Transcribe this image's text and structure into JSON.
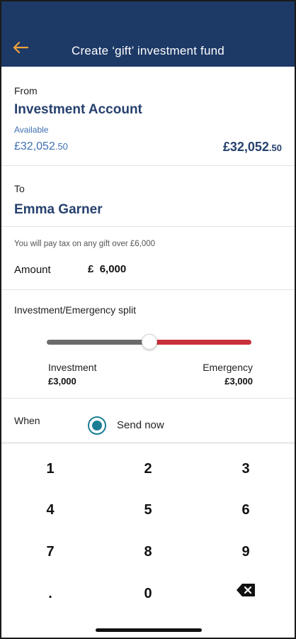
{
  "header": {
    "title": "Create ‘gift’ investment fund",
    "back_icon": "arrow-left-icon"
  },
  "from": {
    "label": "From",
    "account_name": "Investment Account",
    "available_label": "Available",
    "available_pounds": "£32,052",
    "available_pence": ".50",
    "balance_pounds": "£32,052",
    "balance_pence": ".50"
  },
  "to": {
    "label": "To",
    "recipient": "Emma Garner"
  },
  "amount": {
    "note": "You will pay tax on any gift over £6,000",
    "label": "Amount",
    "currency": "£",
    "value": "6,000"
  },
  "split": {
    "title": "Investment/Emergency split",
    "investment_fraction": 0.5,
    "left_color": "#6b6b6b",
    "right_color": "#c8303a",
    "investment_label": "Investment",
    "investment_value": "£3,000",
    "emergency_label": "Emergency",
    "emergency_value": "£3,000"
  },
  "when": {
    "label": "When",
    "option": "Send now",
    "selected": true,
    "accent": "#1b7e94"
  },
  "keypad": {
    "keys": [
      "1",
      "2",
      "3",
      "4",
      "5",
      "6",
      "7",
      "8",
      "9",
      ".",
      "0"
    ],
    "delete_icon": "backspace-icon"
  },
  "colors": {
    "header_bg": "#1d3966",
    "back_arrow": "#f0a33a",
    "title_blue": "#26416e",
    "link_blue": "#3f6fb0"
  }
}
